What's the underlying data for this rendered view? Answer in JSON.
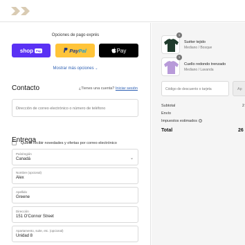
{
  "brand": {
    "logo_icon": "double-chevron-logo-icon",
    "logo_color": "#d9cbb3"
  },
  "express": {
    "title": "Opciones de pago exprés",
    "shop_label": "shop",
    "shop_tag": "Pay",
    "paypal_pay": "Pay",
    "paypal_pal": "Pal",
    "apple_label": "Pay",
    "more_label": "Mostrar más opciones",
    "colors": {
      "shop": "#5a31f4",
      "paypal": "#ffc439",
      "apple": "#000000"
    }
  },
  "contact": {
    "title": "Contacto",
    "account_prompt": "¿Tienes una cuenta?",
    "login_link": "Iniciar sesión",
    "email_placeholder": "Dirección de correo electrónico o número de teléfono",
    "newsletter_label": "Quiero recibir novedades y ofertas por correo electrónico"
  },
  "delivery": {
    "title": "Entrega",
    "country_label": "País/región",
    "country_value": "Canadá",
    "first_name_label": "Nombre (opcional)",
    "first_name_value": "Alex",
    "last_name_label": "Apellido",
    "last_name_value": "Greene",
    "address_label": "Dirección",
    "address_value": "151 O'Connor Street",
    "apartment_label": "Apartamento, suite, etc. (opcional)",
    "apartment_value": "Unidad 8"
  },
  "cart": {
    "items": [
      {
        "name": "Suéter tejido",
        "variant": "Mediano / Bosque",
        "qty": "1",
        "color": "#1f3b2c"
      },
      {
        "name": "Cuello redondo trenzado",
        "variant": "Mediano / Lavanda",
        "qty": "1",
        "color": "#b89ad9"
      }
    ],
    "discount_placeholder": "Código de descuento o tarjeta",
    "apply_label": "Ap",
    "subtotal_label": "Subtotal",
    "subtotal_value": "2",
    "shipping_label": "Envío",
    "taxes_label": "Impuestos estimados",
    "total_label": "Total",
    "total_value": "26"
  }
}
